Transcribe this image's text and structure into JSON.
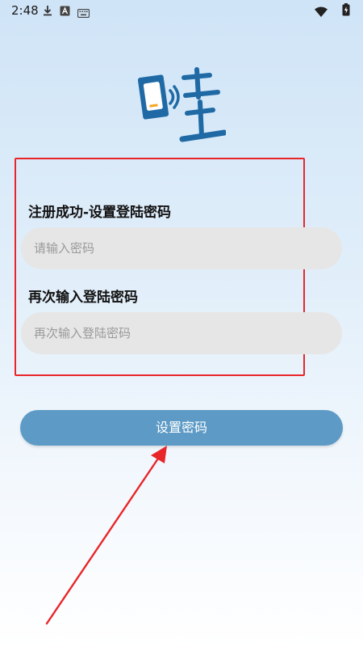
{
  "status_bar": {
    "time": "2:48",
    "icons": [
      "download-icon",
      "a-box-icon",
      "keyboard-icon",
      "wifi-icon",
      "battery-icon"
    ]
  },
  "logo": {
    "glyph": "哇",
    "color": "#1f6aa5",
    "accent": "#f5a623"
  },
  "form": {
    "password_label": "注册成功-设置登陆密码",
    "password_placeholder": "请输入密码",
    "confirm_label": "再次输入登陆密码",
    "confirm_placeholder": "再次输入登陆密码"
  },
  "submit_label": "设置密码",
  "colors": {
    "button": "#5d9bc6",
    "annotation": "#e8262a",
    "input_bg": "#e6e6e6"
  }
}
